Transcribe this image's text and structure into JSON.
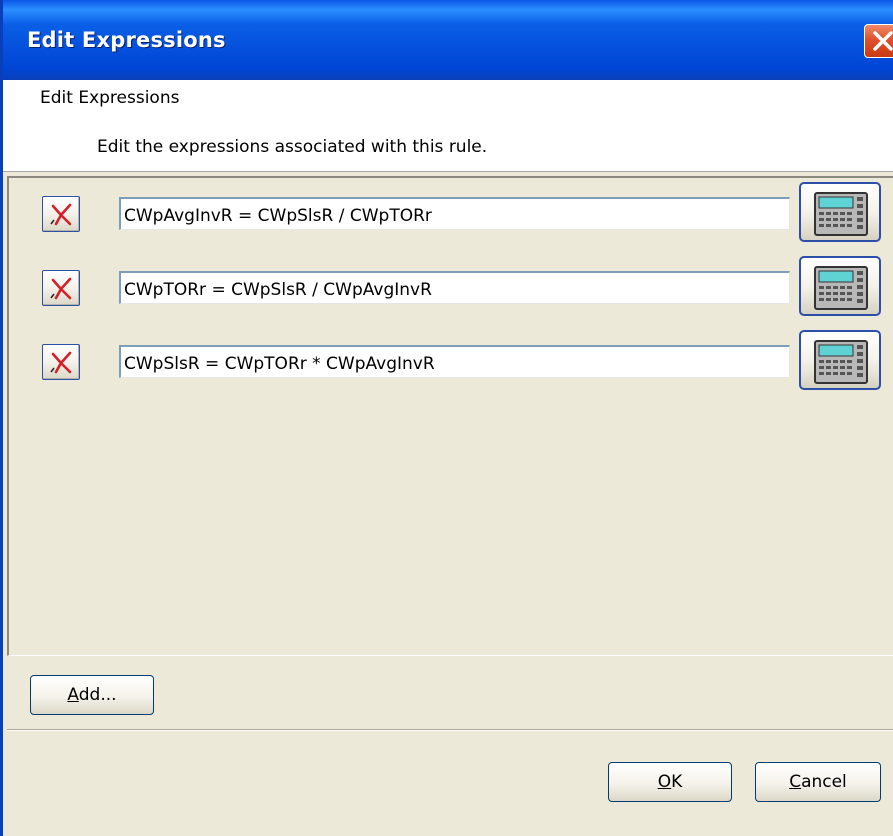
{
  "window": {
    "title": "Edit Expressions"
  },
  "header": {
    "title": "Edit Expressions",
    "subtitle": "Edit the expressions associated with this rule."
  },
  "expressions": [
    {
      "value": "CWpAvgInvR = CWpSlsR / CWpTORr"
    },
    {
      "value": "CWpTORr = CWpSlsR / CWpAvgInvR"
    },
    {
      "value": "CWpSlsR = CWpTORr * CWpAvgInvR"
    }
  ],
  "buttons": {
    "add_mnemonic": "A",
    "add_rest": "dd...",
    "ok_mnemonic": "O",
    "ok_rest": "K",
    "cancel_mnemonic": "C",
    "cancel_rest": "ancel"
  },
  "icons": {
    "close": "close-icon",
    "delete": "delete-expression-icon",
    "calculator": "calculator-icon"
  },
  "colors": {
    "titlebar": "#0a5fe6",
    "close": "#e0502c",
    "dialog_bg": "#ece9d8",
    "delete_mark": "#d4202a"
  }
}
